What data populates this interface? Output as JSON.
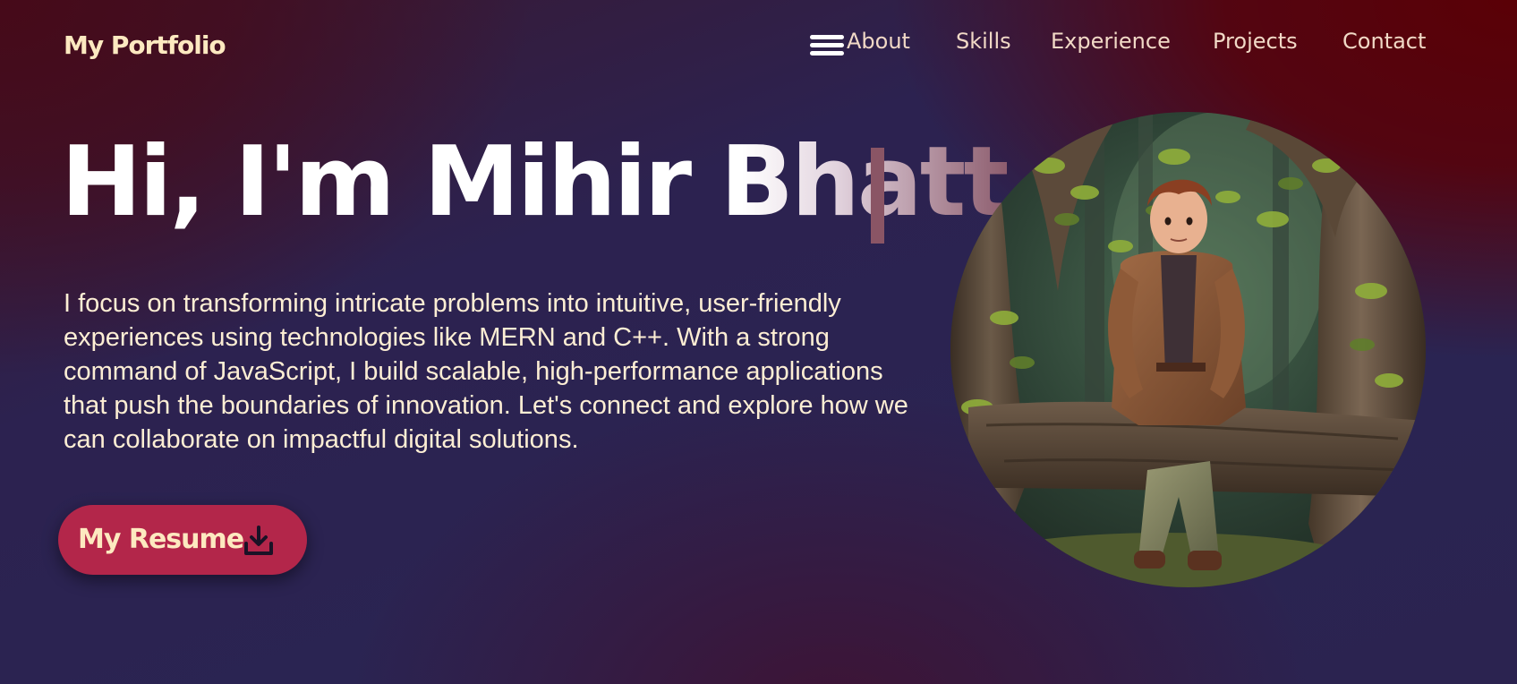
{
  "navbar": {
    "brand": "My Portfolio",
    "menu_icon": "hamburger-menu-icon",
    "links": [
      "About",
      "Skills",
      "Experience",
      "Projects",
      "Contact"
    ]
  },
  "hero": {
    "title": "Hi, I'm Mihir Bhatt",
    "description": "I focus on transforming intricate problems into intuitive, user-friendly experiences using technologies like MERN and C++. With a strong command of JavaScript, I build scalable, high-performance applications that push the boundaries of innovation. Let's connect and explore how we can collaborate on impactful digital solutions.",
    "resume_button": {
      "label": "My Resume",
      "icon": "download-icon"
    }
  },
  "avatar": {
    "icon": "avatar-illustration"
  },
  "colors": {
    "brand_text": "#fde9c0",
    "button_bg": "#b3264a",
    "nav_text": "#f1d9c6",
    "body_text": "#fdeed4"
  }
}
